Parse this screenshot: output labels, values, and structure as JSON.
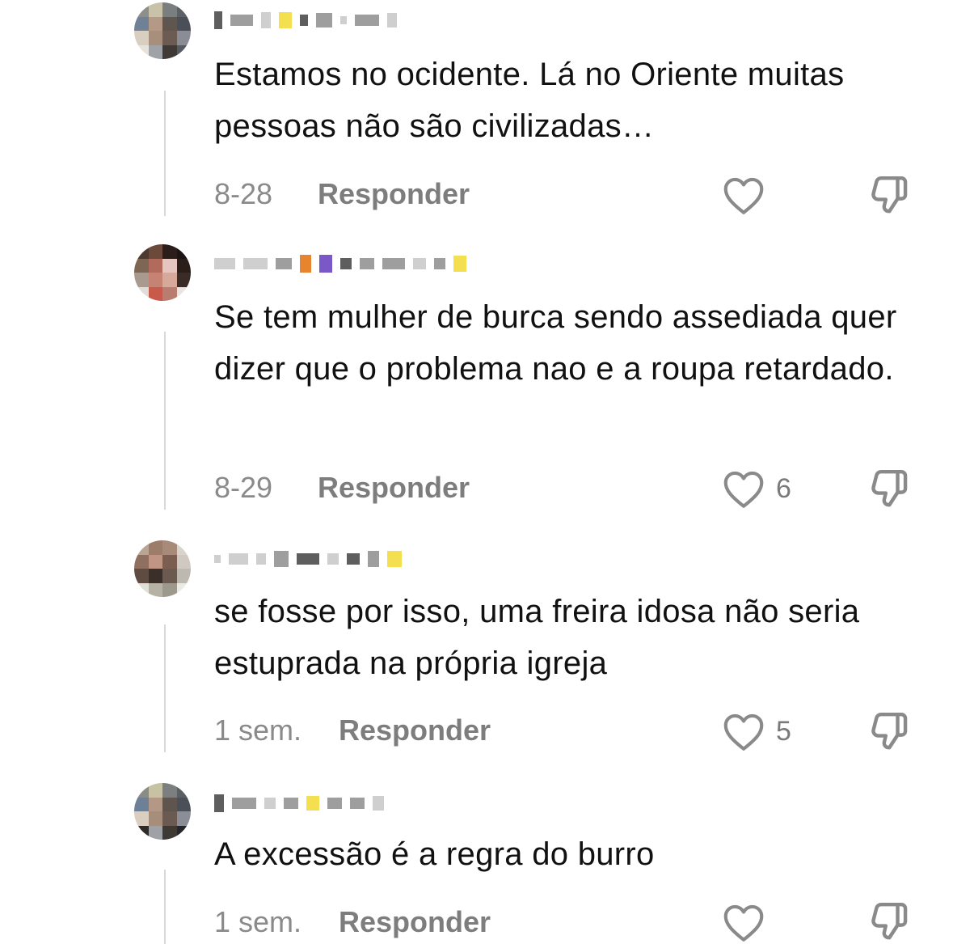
{
  "comments": [
    {
      "text": "Estamos no ocidente. Lá no Oriente muitas pessoas não são civilizadas…",
      "time": "8-28",
      "reply_label": "Responder",
      "likes": "",
      "avatar_colors": [
        "#8d8f8a",
        "#c9c2a8",
        "#7b7e7f",
        "#5c6168",
        "#6e8196",
        "#b49a86",
        "#5f574f",
        "#4a4f58",
        "#d9cfc0",
        "#a88f7b",
        "#6b5b52",
        "#8a8d95",
        "#e7e2da",
        "#9fa3a8",
        "#3f3a36",
        "#565a61"
      ]
    },
    {
      "text": "Se tem mulher de burca sendo assediada quer dizer que o problema nao e a roupa retardado.",
      "time": "8-29",
      "reply_label": "Responder",
      "likes": "6",
      "avatar_colors": [
        "#4a3a33",
        "#6b4a3c",
        "#2a1d1a",
        "#1c1412",
        "#7d6654",
        "#b06b5d",
        "#e6c4c0",
        "#2b1d18",
        "#a89a8f",
        "#c68373",
        "#d7a99b",
        "#3a2b26",
        "#e3ddd9",
        "#c85a4c",
        "#b87c70",
        "#e9e5e3"
      ]
    },
    {
      "text": "se fosse por isso, uma freira idosa não seria estuprada na própria igreja",
      "time": "1 sem.",
      "reply_label": "Responder",
      "likes": "5",
      "avatar_colors": [
        "#b9a595",
        "#9c7d6a",
        "#a78a78",
        "#d9d3cb",
        "#8e6f60",
        "#c09583",
        "#7c5e50",
        "#cfc9c1",
        "#5f4b41",
        "#3a3029",
        "#6b5a4f",
        "#bdb9b1",
        "#dfe0d8",
        "#b6b2a4",
        "#9d9a8d",
        "#eceae4"
      ]
    },
    {
      "text": "A excessão é a regra do burro",
      "time": "1 sem.",
      "reply_label": "Responder",
      "likes": "",
      "avatar_colors": [
        "#8a8c86",
        "#c7c2a3",
        "#7c7f80",
        "#5a5f66",
        "#6d8096",
        "#b39985",
        "#5e564e",
        "#4b4f58",
        "#d9cebf",
        "#a78e7a",
        "#6a5a51",
        "#8b8e96",
        "#2f2b28",
        "#9ea2a7",
        "#3e3935",
        "#24262a"
      ]
    }
  ],
  "icons": {
    "heart": "heart-outline-icon",
    "dislike": "thumbs-down-outline-icon"
  }
}
